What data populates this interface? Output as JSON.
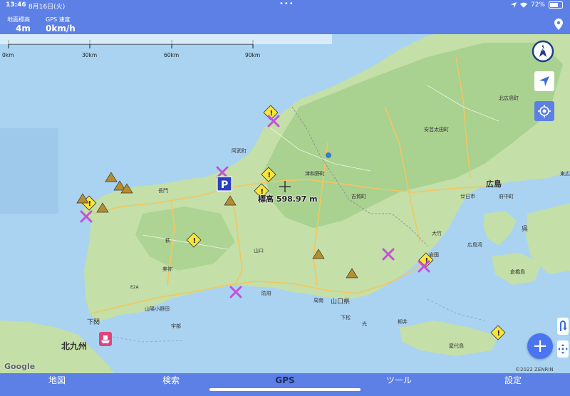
{
  "status_bar": {
    "time": "13:46",
    "date": "8月16日(火)",
    "dots": "•••",
    "battery": "72%"
  },
  "top_panel": {
    "elevation_label": "地面標高",
    "elevation_value": "4m",
    "speed_label": "GPS 速度",
    "speed_value": "0km/h",
    "pin_icon": "location-pin-icon"
  },
  "scale_bar": {
    "ticks": [
      "0km",
      "30km",
      "60km",
      "90km"
    ]
  },
  "map": {
    "elevation_readout": "標高 598.97 m",
    "place_labels": [
      {
        "text": "北広島町",
        "size": 7
      },
      {
        "text": "安芸太田町",
        "size": 7
      },
      {
        "text": "阿武町",
        "size": 7
      },
      {
        "text": "津和野町",
        "size": 7
      },
      {
        "text": "吉賀町",
        "size": 7
      },
      {
        "text": "長門",
        "size": 7
      },
      {
        "text": "萩",
        "size": 7
      },
      {
        "text": "美祢",
        "size": 7
      },
      {
        "text": "山口",
        "size": 7
      },
      {
        "text": "防府",
        "size": 7
      },
      {
        "text": "山陽小野田",
        "size": 7
      },
      {
        "text": "宇部",
        "size": 7
      },
      {
        "text": "周南",
        "size": 7
      },
      {
        "text": "山口県",
        "size": 9
      },
      {
        "text": "下松",
        "size": 7
      },
      {
        "text": "光",
        "size": 7
      },
      {
        "text": "柳井",
        "size": 7
      },
      {
        "text": "岩国",
        "size": 7
      },
      {
        "text": "大竹",
        "size": 7
      },
      {
        "text": "廿日市",
        "size": 7
      },
      {
        "text": "広島",
        "size": 11
      },
      {
        "text": "府中町",
        "size": 7
      },
      {
        "text": "東広",
        "size": 7
      },
      {
        "text": "呉",
        "size": 9
      },
      {
        "text": "倉橋島",
        "size": 7
      },
      {
        "text": "広島湾",
        "size": 7
      },
      {
        "text": "屋代島",
        "size": 7
      },
      {
        "text": "下関",
        "size": 9
      },
      {
        "text": "北九州",
        "size": 12
      },
      {
        "text": "E2A",
        "size": 6
      }
    ],
    "google_logo": "Google",
    "copyright": "©2022 ZENRIN"
  },
  "controls": {
    "compass_letter": "N",
    "nav_icon": "navigation-arrow-icon",
    "locate_icon": "locate-crosshair-icon",
    "add_label": "+"
  },
  "tabs": [
    {
      "label": "地図",
      "active": false
    },
    {
      "label": "検索",
      "active": false
    },
    {
      "label": "GPS",
      "active": true
    },
    {
      "label": "ツール",
      "active": false
    },
    {
      "label": "設定",
      "active": false
    }
  ],
  "colors": {
    "accent": "#5d80e6",
    "sea": "#a9d3f1",
    "land": "#c4dfa8",
    "forest": "#a5cf8c",
    "road": "#f3c660",
    "warning": "#f9e43a",
    "restaurant": "#c84de0",
    "parking": "#2a3fc0",
    "campsite": "#b58e2f",
    "ferry": "#e0457a"
  }
}
